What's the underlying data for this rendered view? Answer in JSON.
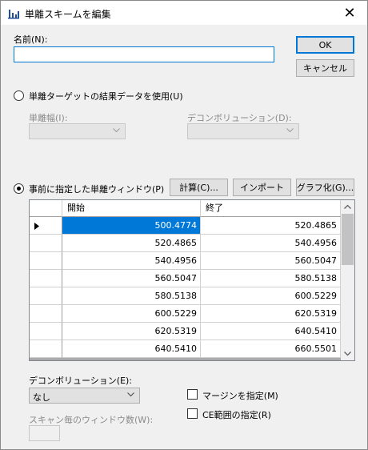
{
  "window": {
    "title": "単離スキームを編集",
    "icon": "chart-icon",
    "close": "✕"
  },
  "name_field": {
    "label": "名前(N):",
    "value": ""
  },
  "buttons": {
    "ok": "OK",
    "cancel": "キャンセル",
    "calc": "計算(C)...",
    "import": "インポート",
    "graph": "グラフ化(G)..."
  },
  "target_option": {
    "label": "単離ターゲットの結果データを使用(U)",
    "selected": false,
    "width_label": "単離幅(I):",
    "deconv_label": "デコンボリューション(D):"
  },
  "window_option": {
    "label": "事前に指定した単離ウィンドウ(P)",
    "selected": true
  },
  "table": {
    "columns": [
      "開始",
      "終了"
    ],
    "rows": [
      [
        "500.4774",
        "520.4865"
      ],
      [
        "520.4865",
        "540.4956"
      ],
      [
        "540.4956",
        "560.5047"
      ],
      [
        "560.5047",
        "580.5138"
      ],
      [
        "580.5138",
        "600.5229"
      ],
      [
        "600.5229",
        "620.5319"
      ],
      [
        "620.5319",
        "640.5410"
      ],
      [
        "640.5410",
        "660.5501"
      ]
    ],
    "current_row": 0
  },
  "deconvolution": {
    "label": "デコンボリューション(E):",
    "value": "なし"
  },
  "scan_windows": {
    "label": "スキャン毎のウィンドウ数(W):",
    "value": ""
  },
  "checkboxes": {
    "margin": "マージンを指定(M)",
    "ce_range": "CE範囲の指定(R)"
  }
}
